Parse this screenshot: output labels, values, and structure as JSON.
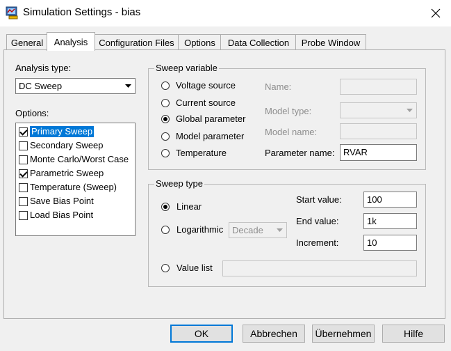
{
  "window": {
    "title": "Simulation Settings - bias",
    "icon": "simulation-app-icon",
    "close_icon": "close-icon"
  },
  "tabs": [
    {
      "label": "General",
      "active": false
    },
    {
      "label": "Analysis",
      "active": true
    },
    {
      "label": "Configuration Files",
      "active": false
    },
    {
      "label": "Options",
      "active": false
    },
    {
      "label": "Data Collection",
      "active": false
    },
    {
      "label": "Probe Window",
      "active": false
    }
  ],
  "analysis": {
    "type_label": "Analysis type:",
    "type_value": "DC Sweep",
    "options_label": "Options:",
    "options": [
      {
        "label": "Primary Sweep",
        "checked": true,
        "selected": true
      },
      {
        "label": "Secondary Sweep",
        "checked": false,
        "selected": false
      },
      {
        "label": "Monte Carlo/Worst Case",
        "checked": false,
        "selected": false
      },
      {
        "label": "Parametric Sweep",
        "checked": true,
        "selected": false
      },
      {
        "label": "Temperature (Sweep)",
        "checked": false,
        "selected": false
      },
      {
        "label": "Save Bias Point",
        "checked": false,
        "selected": false
      },
      {
        "label": "Load Bias Point",
        "checked": false,
        "selected": false
      }
    ]
  },
  "sweep_variable": {
    "title": "Sweep variable",
    "radios": [
      {
        "label": "Voltage source",
        "checked": false
      },
      {
        "label": "Current source",
        "checked": false
      },
      {
        "label": "Global parameter",
        "checked": true
      },
      {
        "label": "Model parameter",
        "checked": false
      },
      {
        "label": "Temperature",
        "checked": false
      }
    ],
    "name_label": "Name:",
    "name_value": "",
    "model_type_label": "Model type:",
    "model_type_value": "",
    "model_name_label": "Model name:",
    "model_name_value": "",
    "param_name_label": "Parameter name:",
    "param_name_value": "RVAR"
  },
  "sweep_type": {
    "title": "Sweep type",
    "linear_label": "Linear",
    "linear_checked": true,
    "log_label": "Logarithmic",
    "log_checked": false,
    "log_scale_value": "Decade",
    "list_label": "Value list",
    "list_checked": false,
    "list_value": "",
    "start_label": "Start value:",
    "start_value": "100",
    "end_label": "End value:",
    "end_value": "1k",
    "inc_label": "Increment:",
    "inc_value": "10"
  },
  "buttons": {
    "ok": "OK",
    "cancel": "Abbrechen",
    "apply": "Übernehmen",
    "help": "Hilfe"
  }
}
